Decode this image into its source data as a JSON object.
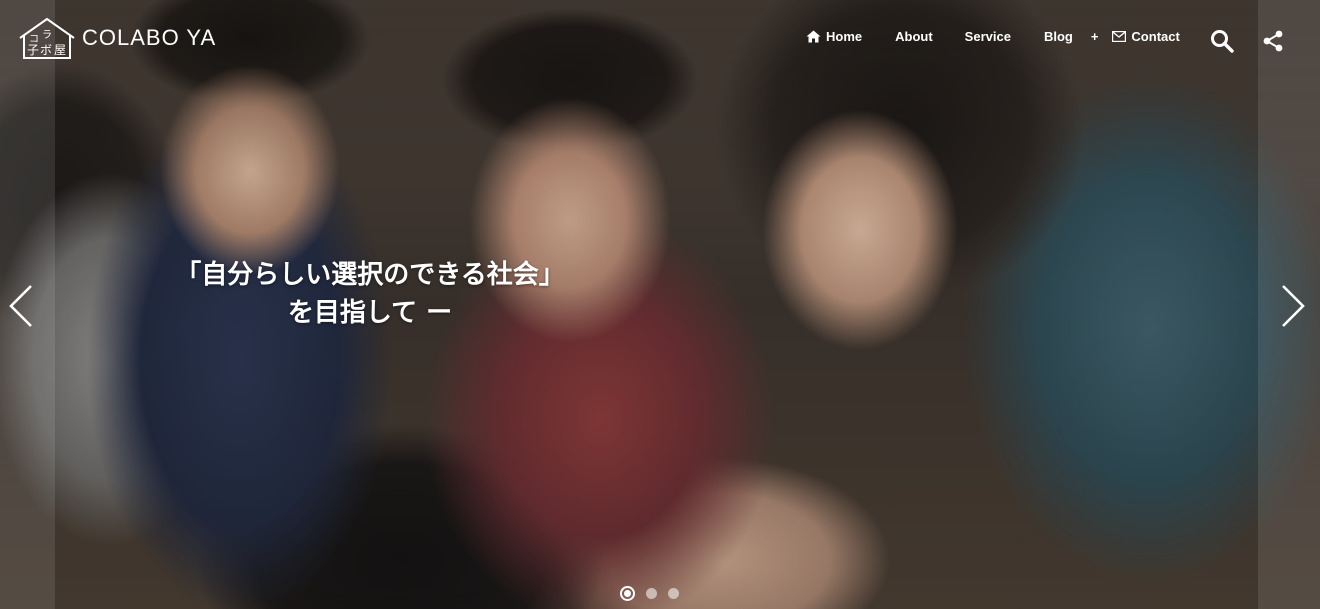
{
  "brand": {
    "logo_text": "COLABO YA",
    "logo_mark_text": "コラボ屋"
  },
  "nav": {
    "items": [
      {
        "label": "Home",
        "icon": "home-icon"
      },
      {
        "label": "About"
      },
      {
        "label": "Service"
      },
      {
        "label": "Blog",
        "has_submenu": true,
        "submenu_indicator": "+"
      },
      {
        "label": "Contact",
        "icon": "mail-icon"
      }
    ],
    "search_icon": "search-icon",
    "share_icon": "share-icon"
  },
  "hero": {
    "line1": "「自分らしい選択のできる社会」",
    "line2": "を目指して ー",
    "prev_icon": "chevron-left-icon",
    "next_icon": "chevron-right-icon"
  },
  "slider": {
    "slide_count": 3,
    "active_slide": 1
  },
  "colors": {
    "text": "#ffffff",
    "overlay": "rgba(0,0,0,0.18)"
  }
}
